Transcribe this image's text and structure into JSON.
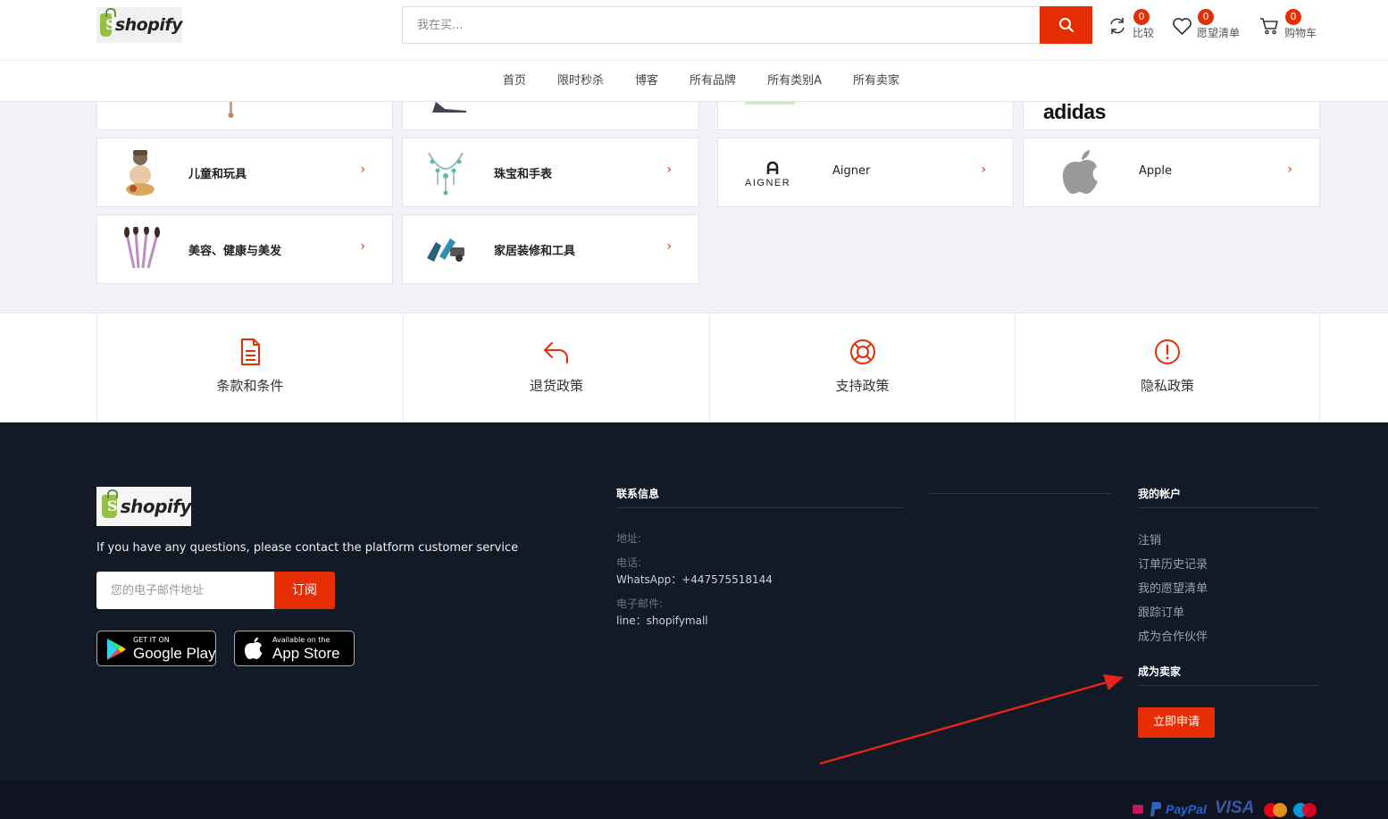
{
  "brand": {
    "logo_text": "shopify"
  },
  "header": {
    "search_placeholder": "我在买...",
    "compare": {
      "count": "0",
      "label": "比较"
    },
    "wishlist": {
      "count": "0",
      "label": "愿望清单"
    },
    "cart": {
      "count": "0",
      "label": "购物车"
    }
  },
  "nav": {
    "items": [
      "首页",
      "限时秒杀",
      "博客",
      "所有品牌",
      "所有类别A",
      "所有卖家"
    ]
  },
  "categories": {
    "partial_brand": "adidas",
    "items": [
      {
        "name": "儿童和玩具",
        "icon": "toy-icon"
      },
      {
        "name": "珠宝和手表",
        "icon": "necklace-icon"
      },
      {
        "name": "Aigner",
        "icon": "aigner-logo",
        "logo_text": "AIGNER"
      },
      {
        "name": "Apple",
        "icon": "apple-logo"
      },
      {
        "name": "美容、健康与美发",
        "icon": "makeup-brushes-icon"
      },
      {
        "name": "家居装修和工具",
        "icon": "tools-icon"
      }
    ],
    "chevron": "›"
  },
  "policies": [
    {
      "label": "条款和条件",
      "icon": "document-icon"
    },
    {
      "label": "退货政策",
      "icon": "return-arrow-icon"
    },
    {
      "label": "支持政策",
      "icon": "lifebuoy-icon"
    },
    {
      "label": "隐私政策",
      "icon": "alert-circle-icon"
    }
  ],
  "footer": {
    "logo_text": "shopify",
    "description": "If you have any questions, please contact the platform customer service",
    "subscribe_placeholder": "您的电子邮件地址",
    "subscribe_button": "订阅",
    "google_play": {
      "small": "GET IT ON",
      "big": "Google Play"
    },
    "app_store": {
      "small": "Available on the",
      "big": "App Store"
    },
    "contact": {
      "title": "联系信息",
      "address_label": "地址:",
      "phone_label": "电话:",
      "phone_value": "WhatsApp：+447575518144",
      "email_label": "电子邮件:",
      "email_value": "line：shopifymall"
    },
    "account": {
      "title": "我的帐户",
      "links": [
        "注销",
        "订单历史记录",
        "我的愿望清单",
        "跟踪订单",
        "成为合作伙伴"
      ]
    },
    "seller": {
      "title": "成为卖家",
      "button": "立即申请"
    },
    "payments": [
      "PayPal",
      "VISA"
    ]
  },
  "colors": {
    "accent": "#e62e04",
    "footer_bg": "#131a27"
  }
}
